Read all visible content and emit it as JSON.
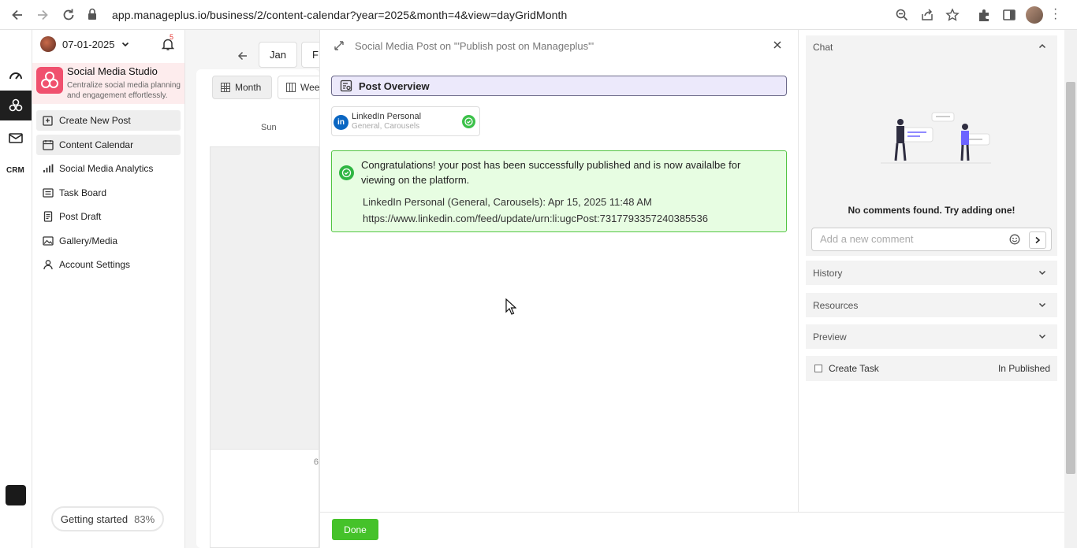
{
  "browser": {
    "url": "app.manageplus.io/business/2/content-calendar?year=2025&month=4&view=dayGridMonth"
  },
  "sidebar": {
    "date": "07-01-2025",
    "notification_count": "5",
    "studio_name": "Social Media Studio",
    "studio_desc": "Centralize social media planning and engagement effortlessly.",
    "items": [
      {
        "label": "Create New Post",
        "icon": "create-post-icon"
      },
      {
        "label": "Content Calendar",
        "icon": "calendar-icon"
      },
      {
        "label": "Social Media Analytics",
        "icon": "analytics-icon"
      },
      {
        "label": "Task Board",
        "icon": "task-board-icon"
      },
      {
        "label": "Post Draft",
        "icon": "draft-icon"
      },
      {
        "label": "Gallery/Media",
        "icon": "gallery-icon"
      },
      {
        "label": "Account Settings",
        "icon": "user-icon"
      }
    ],
    "getting_started_label": "Getting started",
    "getting_started_percent": "83%"
  },
  "calendar": {
    "month_buttons": [
      "Jan",
      "F"
    ],
    "view_buttons": [
      "Month",
      "Wee"
    ],
    "day_header": "Sun",
    "day_number": "6"
  },
  "modal": {
    "title": "Social Media Post on '\"Publish post on Manageplus\"'",
    "overview_label": "Post Overview",
    "account": {
      "name": "LinkedIn Personal",
      "sub": "General, Carousels",
      "logo_text": "in"
    },
    "success": {
      "message": "Congratulations! your post has been successfully published and is now availalbe for viewing on the platform.",
      "detail_line": "LinkedIn Personal (General, Carousels): Apr 15, 2025 11:48 AM",
      "url": "https://www.linkedin.com/feed/update/urn:li:ugcPost:7317793357240385536"
    },
    "done_label": "Done"
  },
  "right_pane": {
    "chat_label": "Chat",
    "no_comments": "No comments found. Try adding one!",
    "comment_placeholder": "Add a new comment",
    "sections": [
      "History",
      "Resources",
      "Preview"
    ],
    "task_label": "Create Task",
    "status_label": "In Published"
  },
  "colors": {
    "success_bg": "#e7fde2",
    "success_border": "#53c543",
    "done_button": "#45c22a",
    "overview_bg": "#ece9fb",
    "studio_logo": "#f0506e",
    "linkedin": "#0a66c2"
  }
}
